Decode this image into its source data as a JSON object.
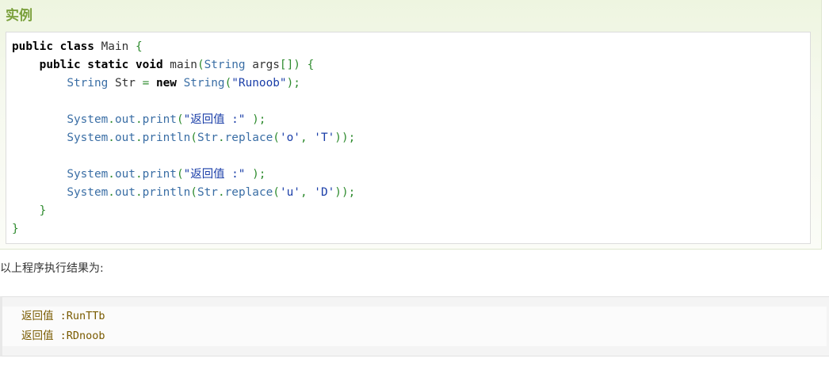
{
  "example": {
    "title": "实例",
    "code_lines": [
      [
        {
          "t": "kw",
          "v": "public class "
        },
        {
          "t": "id",
          "v": "Main "
        },
        {
          "t": "pn",
          "v": "{"
        }
      ],
      [
        {
          "t": "id",
          "v": "    "
        },
        {
          "t": "kw",
          "v": "public static void "
        },
        {
          "t": "id",
          "v": "main"
        },
        {
          "t": "pn",
          "v": "("
        },
        {
          "t": "ty",
          "v": "String "
        },
        {
          "t": "id",
          "v": "args"
        },
        {
          "t": "pn",
          "v": "[]) {"
        }
      ],
      [
        {
          "t": "id",
          "v": "        "
        },
        {
          "t": "ty",
          "v": "String "
        },
        {
          "t": "id",
          "v": "Str "
        },
        {
          "t": "pn",
          "v": "= "
        },
        {
          "t": "kw",
          "v": "new "
        },
        {
          "t": "ty",
          "v": "String"
        },
        {
          "t": "pn",
          "v": "("
        },
        {
          "t": "st",
          "v": "\"Runoob\""
        },
        {
          "t": "pn",
          "v": ");"
        }
      ],
      [],
      [
        {
          "t": "id",
          "v": "        "
        },
        {
          "t": "fn",
          "v": "System"
        },
        {
          "t": "pn",
          "v": "."
        },
        {
          "t": "fn",
          "v": "out"
        },
        {
          "t": "pn",
          "v": "."
        },
        {
          "t": "fn",
          "v": "print"
        },
        {
          "t": "pn",
          "v": "("
        },
        {
          "t": "st",
          "v": "\"返回值 :\" "
        },
        {
          "t": "pn",
          "v": ");"
        }
      ],
      [
        {
          "t": "id",
          "v": "        "
        },
        {
          "t": "fn",
          "v": "System"
        },
        {
          "t": "pn",
          "v": "."
        },
        {
          "t": "fn",
          "v": "out"
        },
        {
          "t": "pn",
          "v": "."
        },
        {
          "t": "fn",
          "v": "println"
        },
        {
          "t": "pn",
          "v": "("
        },
        {
          "t": "fn",
          "v": "Str"
        },
        {
          "t": "pn",
          "v": "."
        },
        {
          "t": "fn",
          "v": "replace"
        },
        {
          "t": "pn",
          "v": "("
        },
        {
          "t": "st",
          "v": "'o'"
        },
        {
          "t": "pn",
          "v": ", "
        },
        {
          "t": "st",
          "v": "'T'"
        },
        {
          "t": "pn",
          "v": "));"
        }
      ],
      [],
      [
        {
          "t": "id",
          "v": "        "
        },
        {
          "t": "fn",
          "v": "System"
        },
        {
          "t": "pn",
          "v": "."
        },
        {
          "t": "fn",
          "v": "out"
        },
        {
          "t": "pn",
          "v": "."
        },
        {
          "t": "fn",
          "v": "print"
        },
        {
          "t": "pn",
          "v": "("
        },
        {
          "t": "st",
          "v": "\"返回值 :\" "
        },
        {
          "t": "pn",
          "v": ");"
        }
      ],
      [
        {
          "t": "id",
          "v": "        "
        },
        {
          "t": "fn",
          "v": "System"
        },
        {
          "t": "pn",
          "v": "."
        },
        {
          "t": "fn",
          "v": "out"
        },
        {
          "t": "pn",
          "v": "."
        },
        {
          "t": "fn",
          "v": "println"
        },
        {
          "t": "pn",
          "v": "("
        },
        {
          "t": "fn",
          "v": "Str"
        },
        {
          "t": "pn",
          "v": "."
        },
        {
          "t": "fn",
          "v": "replace"
        },
        {
          "t": "pn",
          "v": "("
        },
        {
          "t": "st",
          "v": "'u'"
        },
        {
          "t": "pn",
          "v": ", "
        },
        {
          "t": "st",
          "v": "'D'"
        },
        {
          "t": "pn",
          "v": "));"
        }
      ],
      [
        {
          "t": "id",
          "v": "    "
        },
        {
          "t": "pn",
          "v": "}"
        }
      ],
      [
        {
          "t": "pn",
          "v": "}"
        }
      ]
    ]
  },
  "result": {
    "caption": "以上程序执行结果为:",
    "output_lines": [
      "返回值 :RunTTb",
      "返回值 :RDnoob"
    ]
  },
  "colors": {
    "title_green": "#7aa03c",
    "keyword": "#000000",
    "type_blue": "#3a6ea5",
    "string_blue": "#1a3ea8",
    "punct_green": "#2e8b2e",
    "output_text": "#7a5b00"
  }
}
